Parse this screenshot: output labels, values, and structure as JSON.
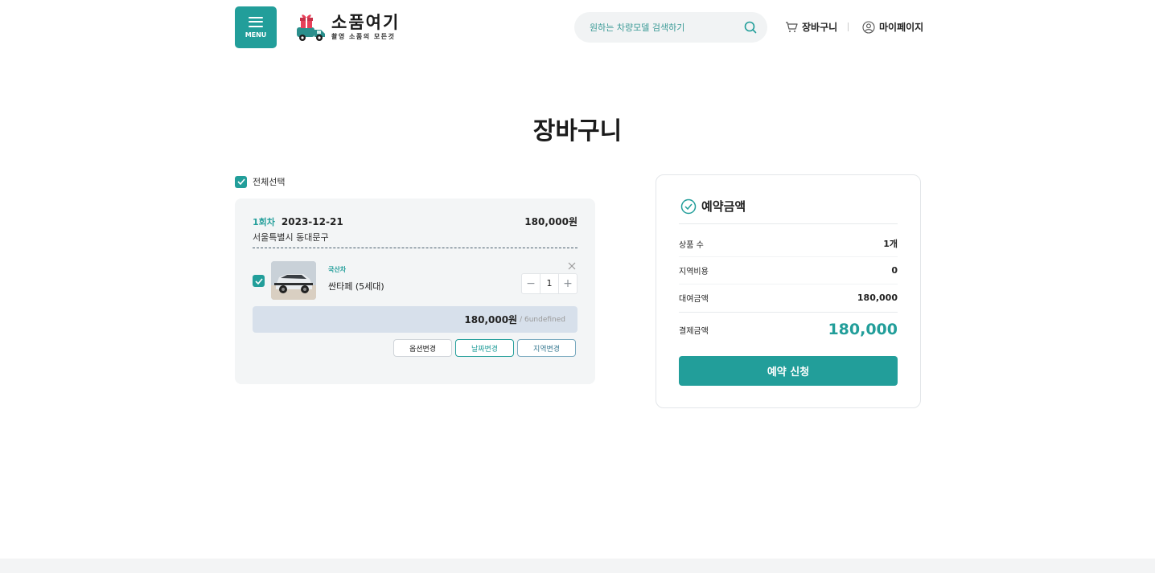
{
  "header": {
    "menu_label": "MENU",
    "logo_title": "소품여기",
    "logo_subtitle": "촬영 소품의 모든것",
    "search_placeholder": "원하는 차량모델 검색하기",
    "cart_label": "장바구니",
    "mypage_label": "마이페이지"
  },
  "page_title": "장바구니",
  "cart": {
    "select_all_label": "전체선택",
    "select_all_checked": true,
    "order": {
      "round": "1회차",
      "date": "2023-12-21",
      "total": "180,000원",
      "address": "서울특별시 동대문구",
      "item": {
        "checked": true,
        "type": "국산차",
        "name": "싼타페 (5세대)",
        "quantity": "1",
        "price": "180,000원",
        "per": "/ 6undefined"
      },
      "buttons": {
        "option_change": "옵션변경",
        "date_change": "날짜변경",
        "region_change": "지역변경"
      }
    }
  },
  "summary": {
    "title": "예약금액",
    "rows": [
      {
        "label": "상품 수",
        "value": "1개"
      },
      {
        "label": "지역비용",
        "value": "0"
      },
      {
        "label": "대여금액",
        "value": "180,000"
      }
    ],
    "payment_label": "결제금액",
    "payment_value": "180,000",
    "reserve_button": "예약 신청"
  },
  "colors": {
    "accent": "#229e9a",
    "price_bar": "#d7e0eb",
    "card_bg": "#f3f5f6"
  }
}
